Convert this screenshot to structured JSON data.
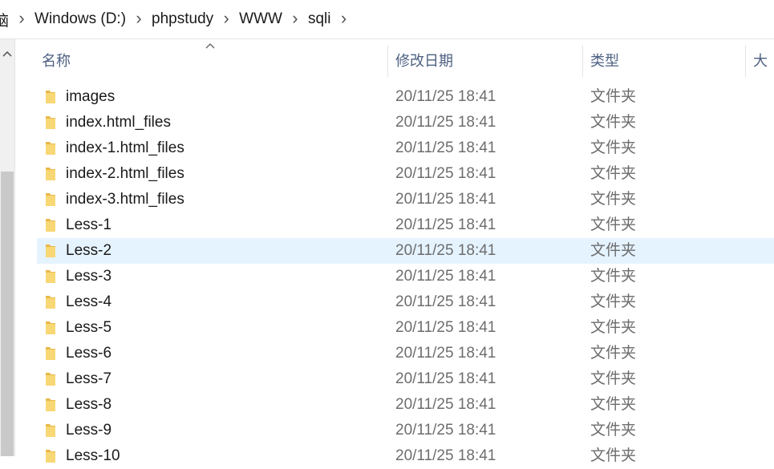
{
  "breadcrumb": {
    "first_partial": "脑",
    "items": [
      "Windows (D:)",
      "phpstudy",
      "WWW",
      "sqli"
    ]
  },
  "columns": {
    "name": "名称",
    "date": "修改日期",
    "type": "类型",
    "size": "大小"
  },
  "files": [
    {
      "name": "images",
      "date": "20/11/25 18:41",
      "type": "文件夹",
      "selected": false
    },
    {
      "name": "index.html_files",
      "date": "20/11/25 18:41",
      "type": "文件夹",
      "selected": false
    },
    {
      "name": "index-1.html_files",
      "date": "20/11/25 18:41",
      "type": "文件夹",
      "selected": false
    },
    {
      "name": "index-2.html_files",
      "date": "20/11/25 18:41",
      "type": "文件夹",
      "selected": false
    },
    {
      "name": "index-3.html_files",
      "date": "20/11/25 18:41",
      "type": "文件夹",
      "selected": false
    },
    {
      "name": "Less-1",
      "date": "20/11/25 18:41",
      "type": "文件夹",
      "selected": false
    },
    {
      "name": "Less-2",
      "date": "20/11/25 18:41",
      "type": "文件夹",
      "selected": true
    },
    {
      "name": "Less-3",
      "date": "20/11/25 18:41",
      "type": "文件夹",
      "selected": false
    },
    {
      "name": "Less-4",
      "date": "20/11/25 18:41",
      "type": "文件夹",
      "selected": false
    },
    {
      "name": "Less-5",
      "date": "20/11/25 18:41",
      "type": "文件夹",
      "selected": false
    },
    {
      "name": "Less-6",
      "date": "20/11/25 18:41",
      "type": "文件夹",
      "selected": false
    },
    {
      "name": "Less-7",
      "date": "20/11/25 18:41",
      "type": "文件夹",
      "selected": false
    },
    {
      "name": "Less-8",
      "date": "20/11/25 18:41",
      "type": "文件夹",
      "selected": false
    },
    {
      "name": "Less-9",
      "date": "20/11/25 18:41",
      "type": "文件夹",
      "selected": false
    },
    {
      "name": "Less-10",
      "date": "20/11/25 18:41",
      "type": "文件夹",
      "selected": false
    }
  ],
  "colors": {
    "selected_row": "#e5f3ff",
    "folder_yellow": "#f8d775",
    "header_text": "#4d6082"
  },
  "icons": {
    "folder": "folder-icon",
    "separator": "chevron-right-icon",
    "sort": "sort-up-icon",
    "scroll_up": "scroll-up-arrow-icon"
  }
}
